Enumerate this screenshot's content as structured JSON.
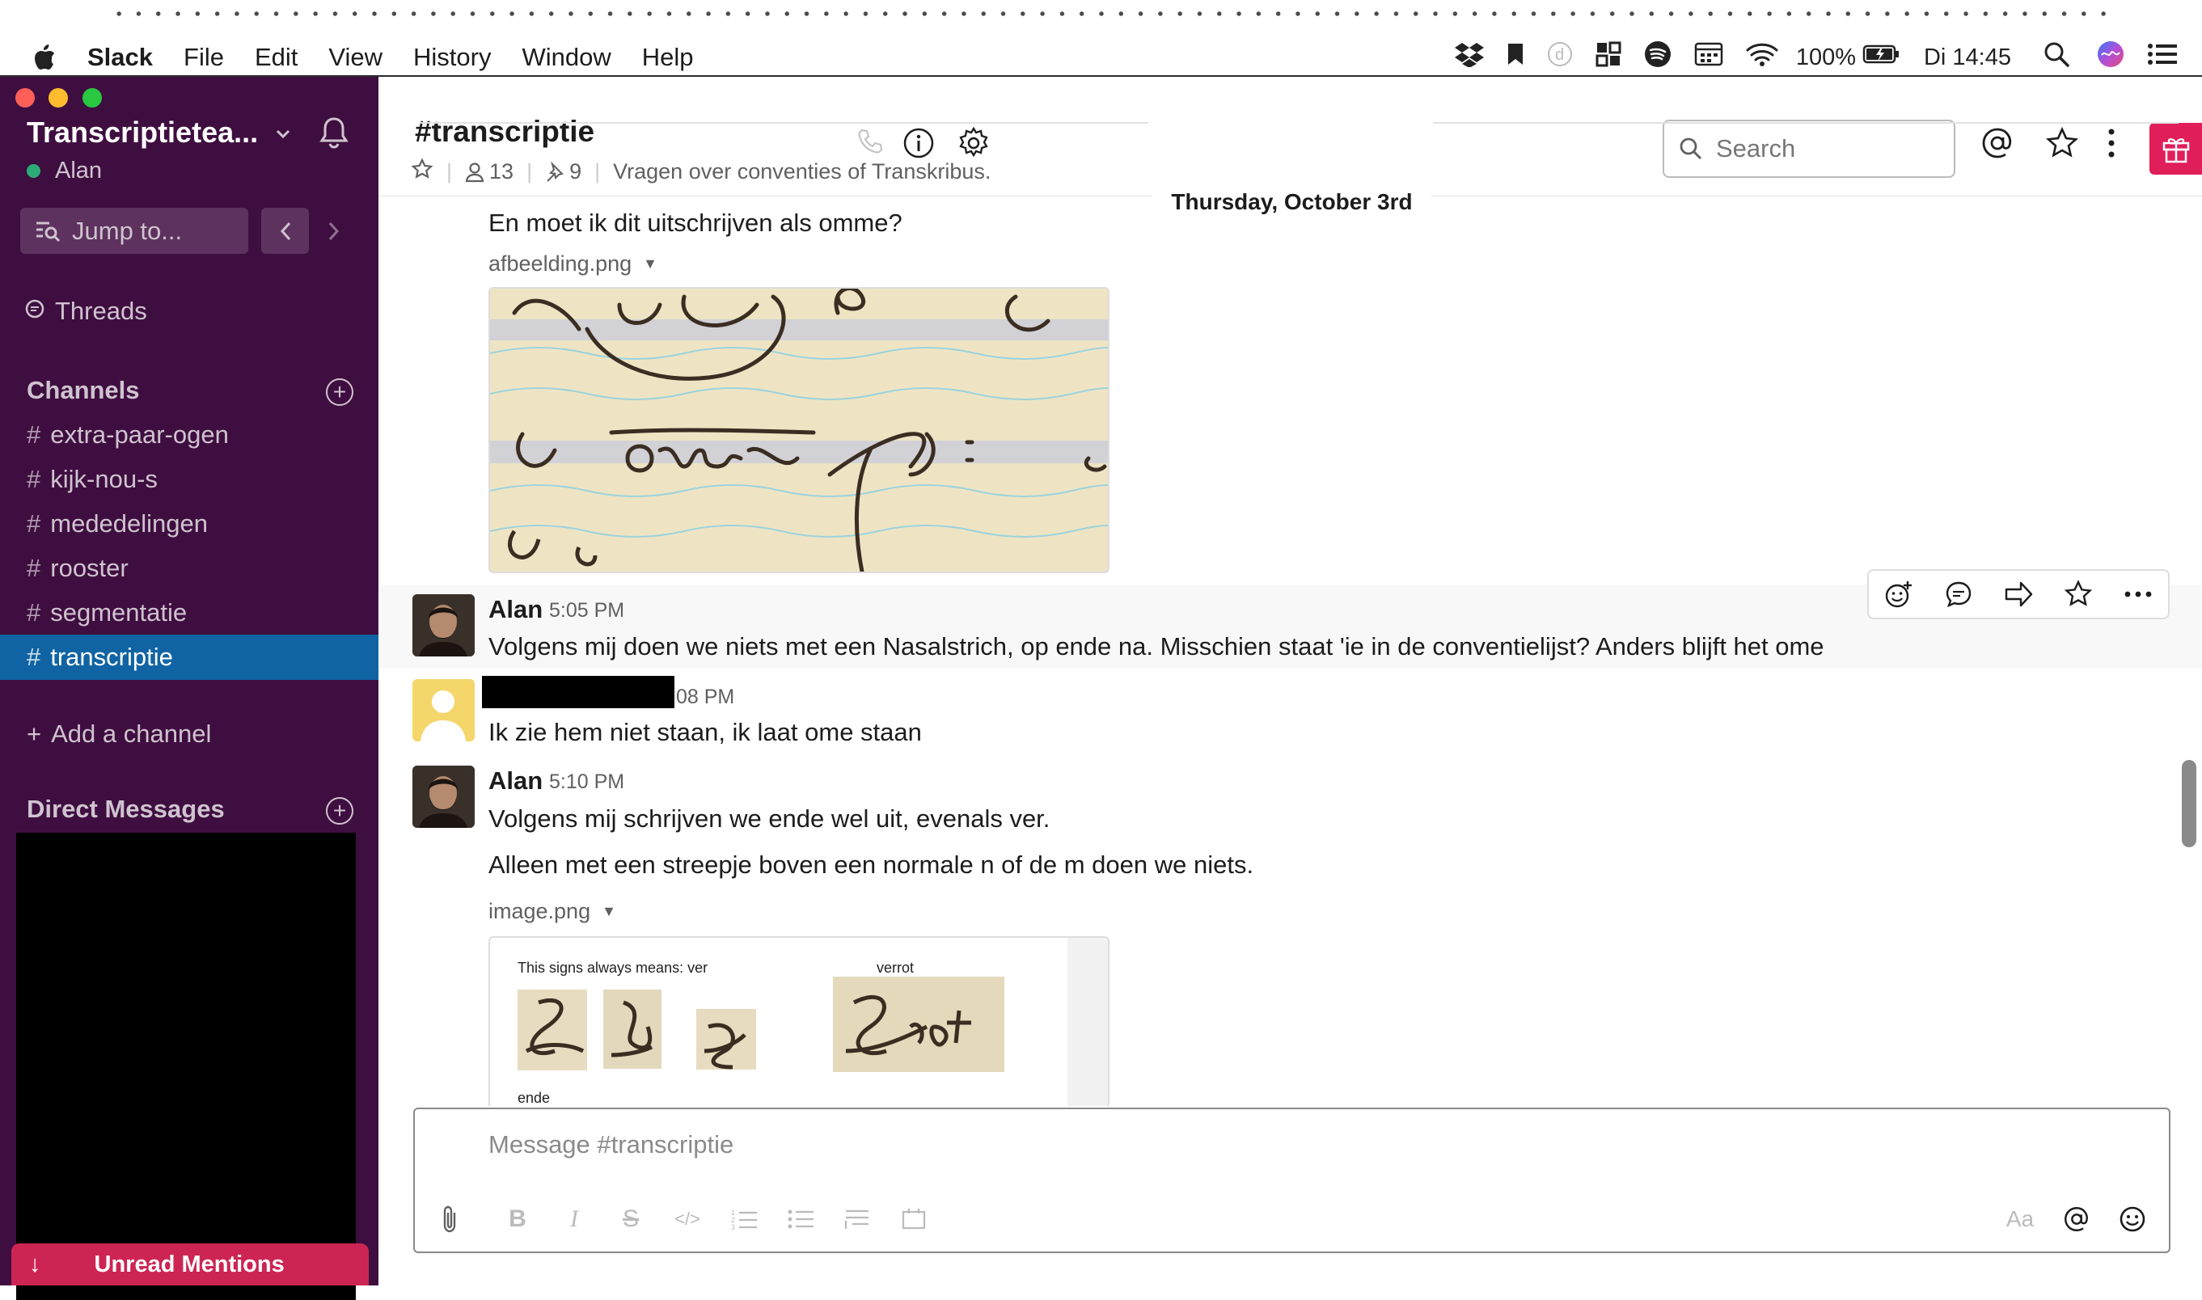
{
  "menubar": {
    "app": "Slack",
    "items": [
      "File",
      "Edit",
      "View",
      "History",
      "Window",
      "Help"
    ],
    "battery": "100%",
    "clock": "Di 14:45"
  },
  "sidebar": {
    "team_name": "Transcriptietea...",
    "user_name": "Alan",
    "jump_label": "Jump to...",
    "threads_label": "Threads",
    "channels_title": "Channels",
    "channels": [
      {
        "name": "extra-paar-ogen"
      },
      {
        "name": "kijk-nou-s"
      },
      {
        "name": "mededelingen"
      },
      {
        "name": "rooster"
      },
      {
        "name": "segmentatie"
      },
      {
        "name": "transcriptie"
      }
    ],
    "add_channel": "Add a channel",
    "dm_title": "Direct Messages",
    "unread_mentions": "Unread Mentions"
  },
  "channel": {
    "name": "#transcriptie",
    "members": "13",
    "pins": "9",
    "topic": "Vragen over conventies of Transkribus.",
    "search_placeholder": "Search"
  },
  "day_divider": "Thursday, October 3rd",
  "messages": {
    "m0_text": "En moet ik dit uitschrijven als omme?",
    "m0_file": "afbeelding.png",
    "m1_author": "Alan",
    "m1_time": "5:05 PM",
    "m1_text": "Volgens mij doen we niets met een Nasalstrich, op ende na. Misschien staat 'ie in de conventielijst? Anders blijft het ome",
    "m2_time": "08 PM",
    "m2_text": "Ik zie hem niet staan, ik laat ome staan",
    "m3_author": "Alan",
    "m3_time": "5:10 PM",
    "m3_text1": "Volgens mij schrijven we ende wel uit, evenals ver.",
    "m3_text2": "Alleen met een streepje boven een normale n of de m doen we niets.",
    "m3_file": "image.png",
    "img2_caption": "This signs always means: ver",
    "img2_word": "verrot",
    "img2_label": "ende"
  },
  "composer": {
    "placeholder": "Message #transcriptie",
    "aa": "Aa"
  }
}
